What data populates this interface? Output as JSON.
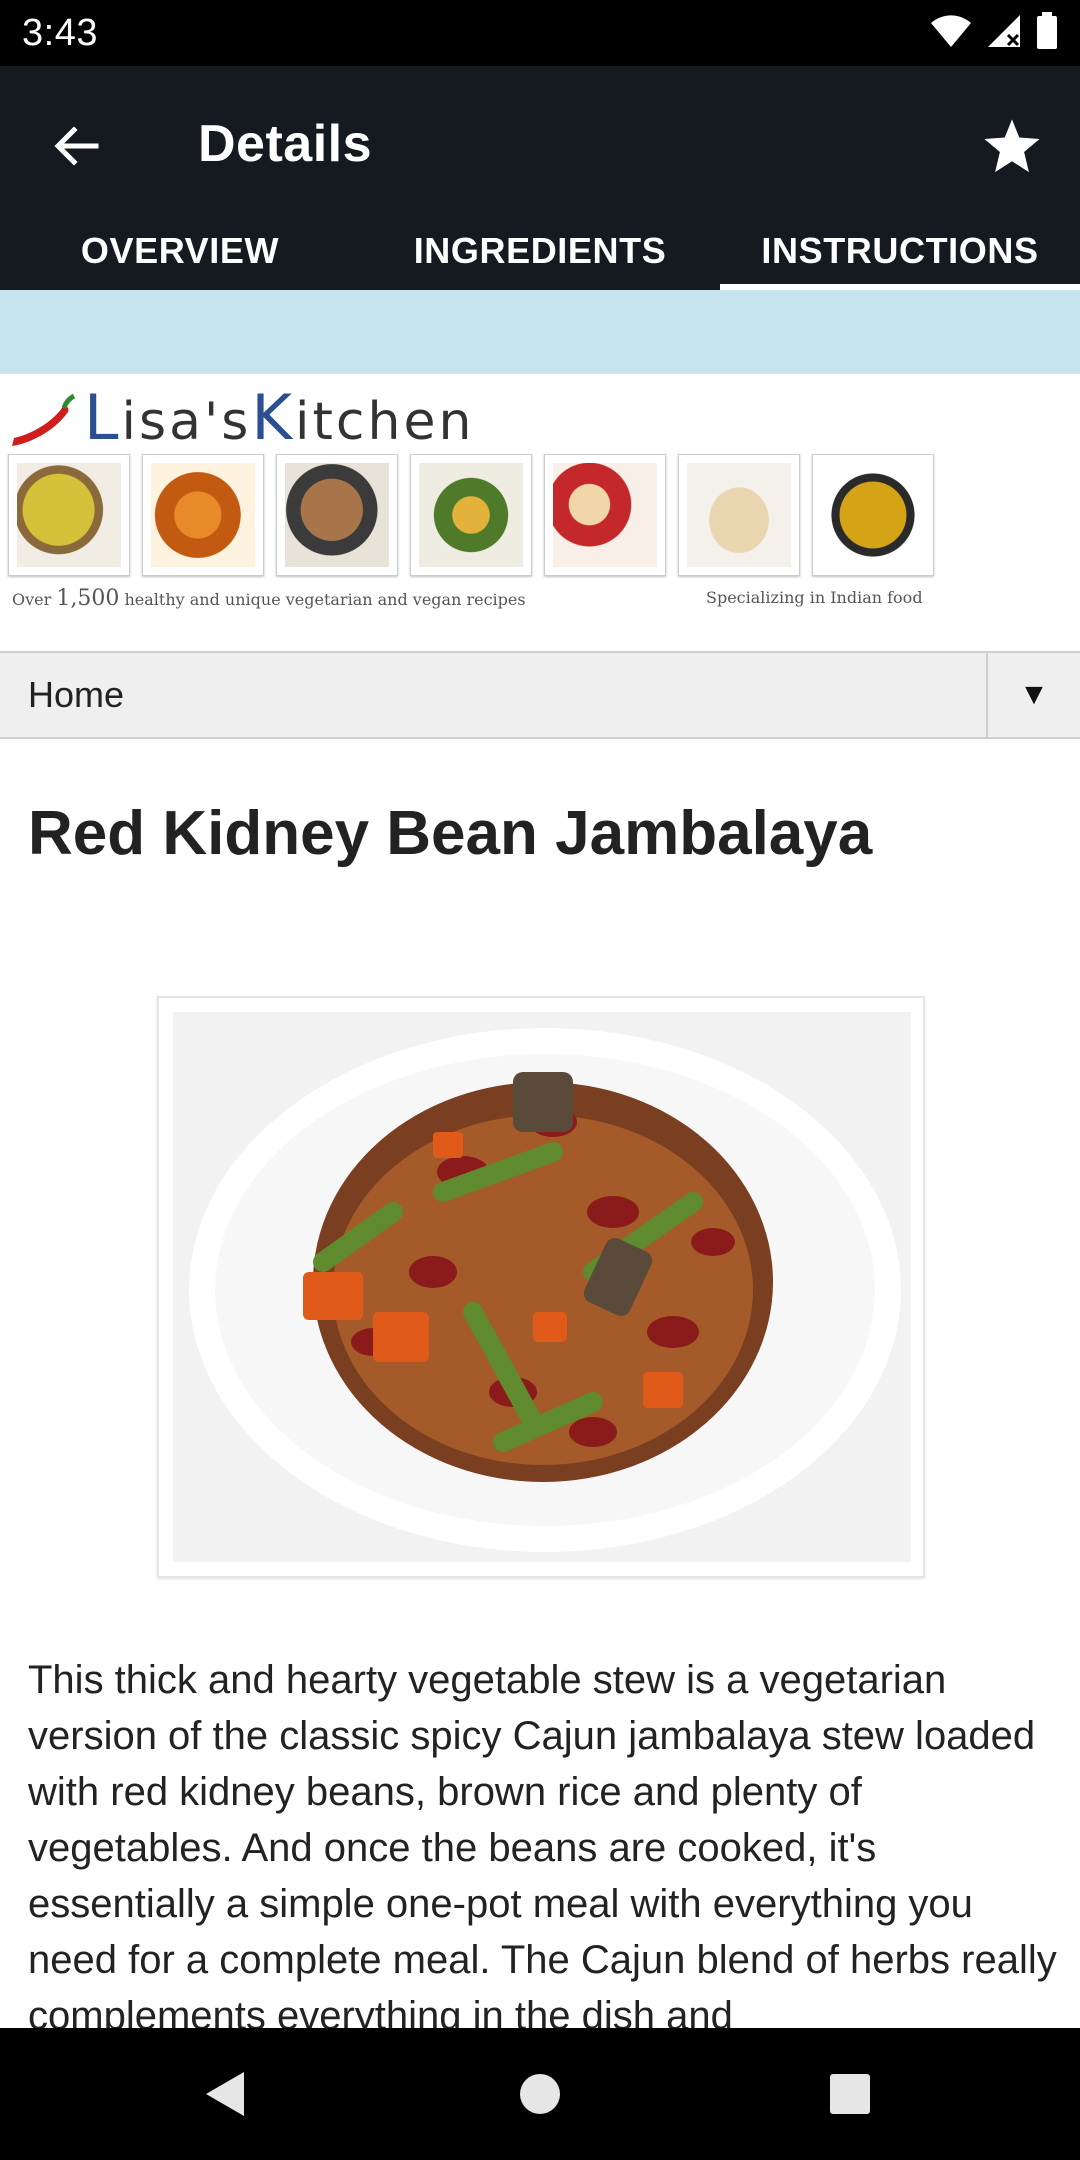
{
  "status_bar": {
    "time": "3:43",
    "icons": [
      "wifi-icon",
      "signal-icon",
      "battery-icon"
    ]
  },
  "app_bar": {
    "title": "Details",
    "back_icon": "arrow-back-icon",
    "favorite_icon": "star-icon"
  },
  "tabs": [
    {
      "label": "OVERVIEW",
      "active": false
    },
    {
      "label": "INGREDIENTS",
      "active": false
    },
    {
      "label": "INSTRUCTIONS",
      "active": true
    }
  ],
  "web": {
    "banner": {
      "logo_text": "Lisa's Kitchen",
      "tagline_left_count": "1,500",
      "tagline_left_prefix": "Over",
      "tagline_left_suffix": "healthy and unique vegetarian and vegan recipes",
      "tagline_right": "Specializing in Indian food"
    },
    "nav_select": {
      "selected": "Home",
      "arrow": "▼"
    },
    "recipe_title": "Red Kidney Bean Jambalaya",
    "description": "This thick and hearty vegetable stew is a vegetarian version of the classic spicy Cajun jambalaya stew loaded with red kidney beans, brown rice and plenty of vegetables. And once the beans are cooked, it's essentially a simple one-pot meal with everything you need for a complete meal. The Cajun blend of herbs really complements everything in the dish and"
  },
  "nav_bar": {
    "buttons": [
      "back-triangle-icon",
      "home-circle-icon",
      "recents-square-icon"
    ]
  },
  "colors": {
    "app_bar": "#151a21",
    "ad_band": "#c7e4ef",
    "logo_blue": "#2c4f94"
  }
}
